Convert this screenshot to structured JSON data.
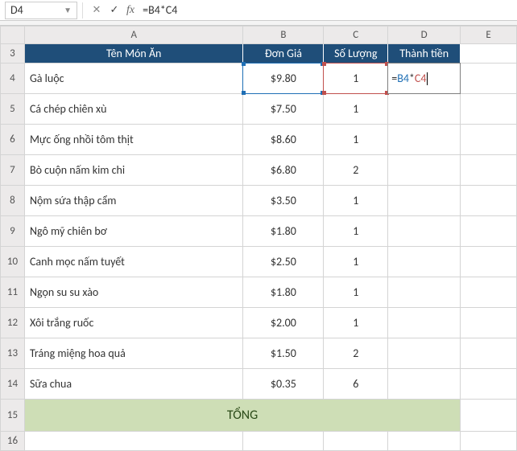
{
  "formula_bar": {
    "name_box": "D4",
    "cancel": "✕",
    "confirm": "✓",
    "fx": "fx",
    "formula": "=B4*C4"
  },
  "col_headers": [
    "A",
    "B",
    "C",
    "D",
    "E"
  ],
  "row_headers": [
    "3",
    "4",
    "5",
    "6",
    "7",
    "8",
    "9",
    "10",
    "11",
    "12",
    "13",
    "14",
    "15",
    "16"
  ],
  "table_header": {
    "name": "Tên Món Ăn",
    "price": "Đơn Giá",
    "qty": "Số Lượng",
    "total": "Thành tiền"
  },
  "edit": {
    "prefix": "=",
    "refB": "B4",
    "op": "*",
    "refC": "C4"
  },
  "rows": [
    {
      "name": "Gà luộc",
      "price": "$9.80",
      "qty": "1"
    },
    {
      "name": "Cá chép chiên xù",
      "price": "$7.50",
      "qty": "1"
    },
    {
      "name": "Mực ống nhồi tôm thịt",
      "price": "$8.60",
      "qty": "1"
    },
    {
      "name": "Bò cuộn nấm kim chi",
      "price": "$6.80",
      "qty": "2"
    },
    {
      "name": "Nộm sứa thập cẩm",
      "price": "$3.50",
      "qty": "1"
    },
    {
      "name": "Ngô mỹ chiên bơ",
      "price": "$1.80",
      "qty": "1"
    },
    {
      "name": "Canh mọc nấm tuyết",
      "price": "$2.50",
      "qty": "1"
    },
    {
      "name": "Ngọn su su xào",
      "price": "$1.80",
      "qty": "1"
    },
    {
      "name": "Xôi trắng ruốc",
      "price": "$2.00",
      "qty": "1"
    },
    {
      "name": "Tráng miệng hoa quả",
      "price": "$1.50",
      "qty": "2"
    },
    {
      "name": "Sữa chua",
      "price": "$0.35",
      "qty": "6"
    }
  ],
  "total_label": "TỔNG"
}
